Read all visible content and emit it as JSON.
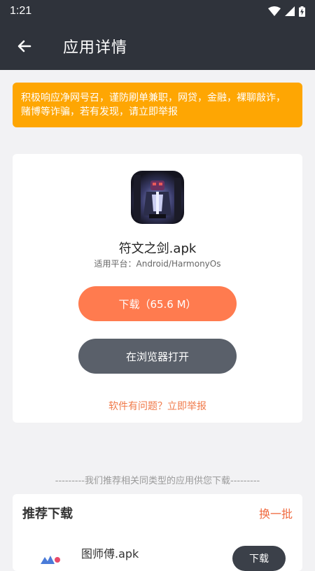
{
  "status_bar": {
    "time": "1:21",
    "icons": [
      "wifi-icon",
      "signal-icon",
      "battery-charging-icon"
    ]
  },
  "header": {
    "back_icon": "arrow-left-icon",
    "title": "应用详情"
  },
  "notice": {
    "text": "积极响应净网号召，谨防刷单兼职，网贷，金融，裸聊敲诈，赌博等诈骗，若有发现，请立即举报"
  },
  "app": {
    "icon": "app-icon-dark-knight",
    "name": "符文之剑.apk",
    "platform": "适用平台：Android/HarmonyOs",
    "download_label": "下载（65.6 M）",
    "browser_label": "在浏览器打开",
    "report_label": "软件有问题？立即举报"
  },
  "recommend": {
    "tip": "---------我们推荐相关同类型的应用供您下载---------",
    "title": "推荐下载",
    "refresh_label": "换一批",
    "items": [
      {
        "name": "图师傅.apk",
        "button_label": "下载"
      }
    ]
  },
  "colors": {
    "header_bg": "#2f333b",
    "notice_bg": "#fea603",
    "download_btn": "#ff7b4f",
    "browser_btn": "#5a606a",
    "report_link": "#f07a4a",
    "refresh_link": "#f06a3f"
  }
}
